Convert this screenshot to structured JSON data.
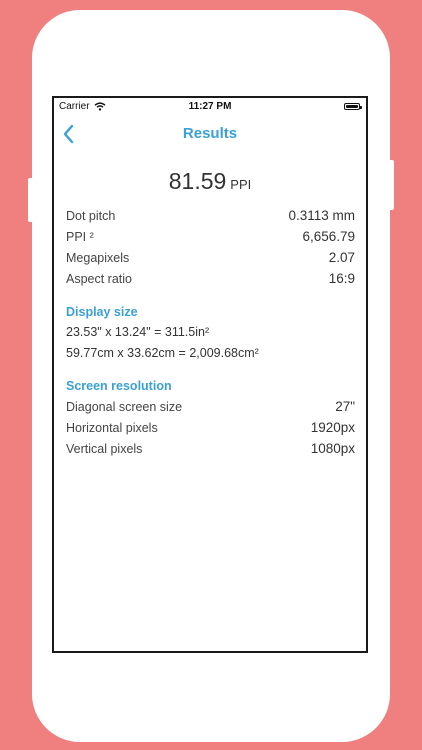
{
  "statusbar": {
    "carrier": "Carrier",
    "time": "11:27 PM",
    "wifi_icon": "wifi-icon",
    "battery_icon": "battery-icon"
  },
  "navbar": {
    "back_icon": "chevron-left-icon",
    "title": "Results"
  },
  "hero": {
    "value": "81.59",
    "unit": "PPI"
  },
  "metrics": [
    {
      "label": "Dot pitch",
      "value": "0.3113 mm"
    },
    {
      "label": "PPI ²",
      "value": "6,656.79"
    },
    {
      "label": "Megapixels",
      "value": "2.07"
    },
    {
      "label": "Aspect ratio",
      "value": "16:9"
    }
  ],
  "display_size": {
    "title": "Display size",
    "lines": [
      "23.53\" x 13.24\" = 311.5in²",
      "59.77cm x 33.62cm = 2,009.68cm²"
    ]
  },
  "screen_resolution": {
    "title": "Screen resolution",
    "rows": [
      {
        "label": "Diagonal screen size",
        "value": "27\""
      },
      {
        "label": "Horizontal pixels",
        "value": "1920px"
      },
      {
        "label": "Vertical pixels",
        "value": "1080px"
      }
    ]
  },
  "colors": {
    "background": "#F08080",
    "accent": "#3AA0D5",
    "text": "#333333"
  }
}
